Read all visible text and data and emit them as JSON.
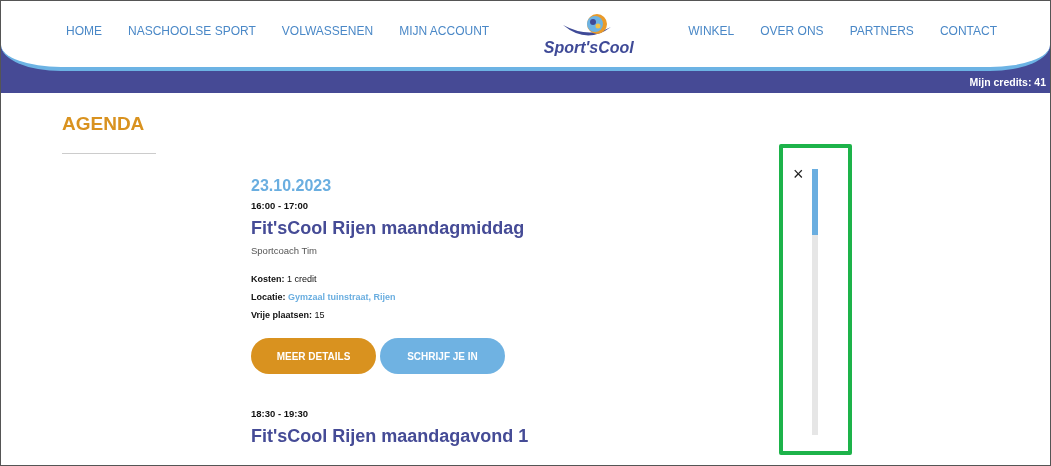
{
  "nav_left": [
    {
      "label": "HOME"
    },
    {
      "label": "NASCHOOLSE SPORT"
    },
    {
      "label": "VOLWASSENEN"
    },
    {
      "label": "MIJN ACCOUNT"
    }
  ],
  "logo": {
    "text": "Sport'sCool"
  },
  "nav_right": [
    {
      "label": "WINKEL"
    },
    {
      "label": "OVER ONS"
    },
    {
      "label": "PARTNERS"
    },
    {
      "label": "CONTACT"
    }
  ],
  "credits": "Mijn credits: 41",
  "page_title": "AGENDA",
  "date": "23.10.2023",
  "events": [
    {
      "time": "16:00 - 17:00",
      "title": "Fit'sCool Rijen maandagmiddag",
      "coach": "Sportcoach Tim",
      "details": [
        {
          "label": "Kosten:",
          "value": "1 credit",
          "link": false
        },
        {
          "label": "Locatie:",
          "value": "Gymzaal tuinstraat, Rijen",
          "link": true
        },
        {
          "label": "Vrije plaatsen:",
          "value": "15",
          "link": false
        }
      ],
      "buttons": [
        {
          "label": "MEER DETAILS",
          "kind": "primary"
        },
        {
          "label": "SCHRIJF JE IN",
          "kind": "secondary"
        }
      ]
    },
    {
      "time": "18:30 - 19:30",
      "title": "Fit'sCool Rijen maandagavond 1"
    }
  ],
  "close": "×"
}
